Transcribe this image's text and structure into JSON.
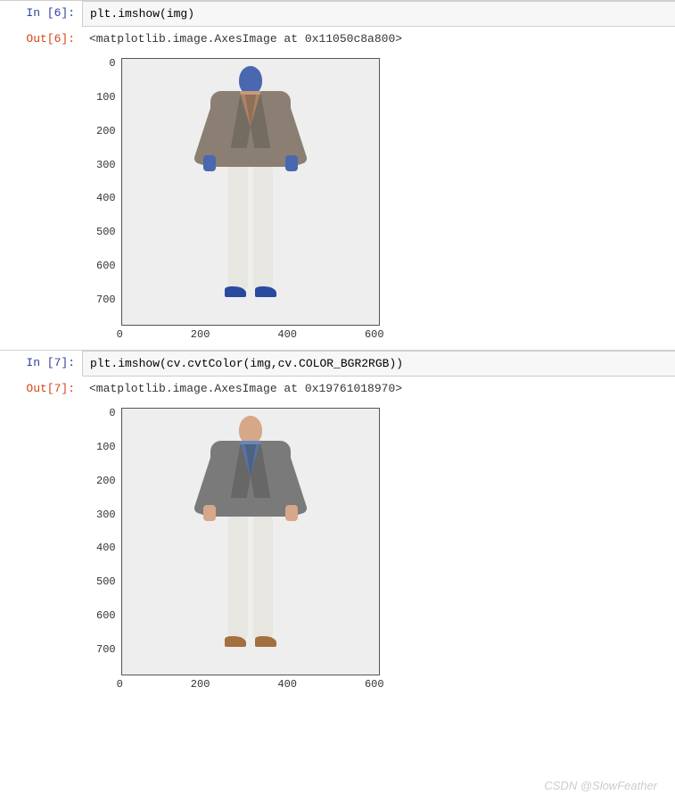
{
  "cells": [
    {
      "in_prompt": "In  [6]:",
      "code": "plt.imshow(img)",
      "out_prompt": "Out[6]:",
      "output_text": "<matplotlib.image.AxesImage at 0x11050c8a800>"
    },
    {
      "in_prompt": "In  [7]:",
      "code": "plt.imshow(cv.cvtColor(img,cv.COLOR_BGR2RGB))",
      "out_prompt": "Out[7]:",
      "output_text": "<matplotlib.image.AxesImage at 0x19761018970>"
    }
  ],
  "chart_data": [
    {
      "type": "image",
      "title": "",
      "xlabel": "",
      "ylabel": "",
      "x_ticks": [
        0,
        200,
        400,
        600
      ],
      "y_ticks": [
        0,
        100,
        200,
        300,
        400,
        500,
        600,
        700
      ],
      "xlim": [
        0,
        700
      ],
      "ylim": [
        750,
        0
      ],
      "description": "Image of a man in a blazer and light trousers displayed with BGR channel order (skin appears blue)."
    },
    {
      "type": "image",
      "title": "",
      "xlabel": "",
      "ylabel": "",
      "x_ticks": [
        0,
        200,
        400,
        600
      ],
      "y_ticks": [
        0,
        100,
        200,
        300,
        400,
        500,
        600,
        700
      ],
      "xlim": [
        0,
        700
      ],
      "ylim": [
        750,
        0
      ],
      "description": "Same image converted to RGB (natural skin tones)."
    }
  ],
  "watermark": "CSDN @SlowFeather"
}
